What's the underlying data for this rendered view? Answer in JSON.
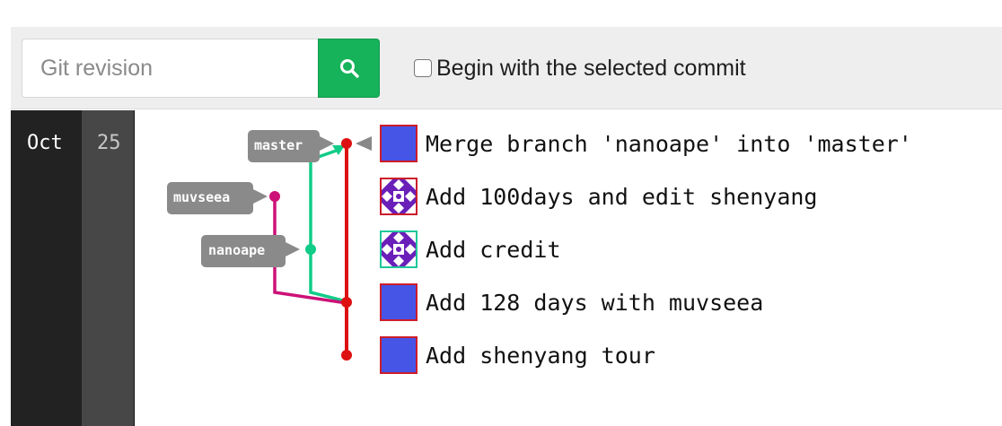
{
  "search": {
    "placeholder": "Git revision",
    "value": ""
  },
  "options": {
    "begin_with_selected_label": "Begin with the selected commit",
    "begin_with_selected_checked": false
  },
  "date": {
    "month": "Oct",
    "day": "25"
  },
  "refs": [
    {
      "name": "master",
      "color": "#dd1111"
    },
    {
      "name": "muvseea",
      "color": "#cc1177"
    },
    {
      "name": "nanoape",
      "color": "#11cc88"
    }
  ],
  "commits": [
    {
      "message": "Merge branch 'nanoape' into 'master'",
      "avatar": "blue",
      "selected": true
    },
    {
      "message": "Add 100days and edit shenyang",
      "avatar": "pattern"
    },
    {
      "message": "Add credit",
      "avatar": "pattern-teal"
    },
    {
      "message": "Add 128 days with muvseea",
      "avatar": "blue"
    },
    {
      "message": "Add shenyang tour",
      "avatar": "blue"
    }
  ],
  "colors": {
    "search_button": "#16b35a",
    "master_branch": "#dd1111",
    "muvseea_branch": "#cc1177",
    "nanoape_branch": "#11cc88",
    "avatar_blue": "#4655e6"
  }
}
